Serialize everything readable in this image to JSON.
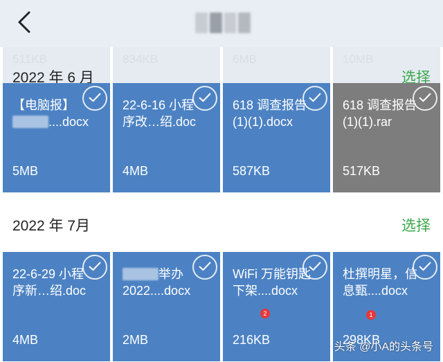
{
  "nav": {
    "back_icon": "chevron-left-icon"
  },
  "peek_row": {
    "sizes": [
      "511KB",
      "834KB",
      "6MB",
      "10MB"
    ]
  },
  "june": {
    "title": "2022 年 6 月",
    "select_label": "选择",
    "tiles": [
      {
        "name_line1": "【电脑报】",
        "name_line2": "....docx",
        "size": "5MB"
      },
      {
        "name_line1": "22-6-16 小程",
        "name_line2": "序改…绍.doc",
        "size": "4MB"
      },
      {
        "name_line1": "618 调查报告",
        "name_line2": "(1)(1).docx",
        "size": "587KB"
      },
      {
        "name_line1": "618 调查报告",
        "name_line2": "(1)(1).rar",
        "size": "517KB"
      }
    ]
  },
  "july": {
    "title": "2022 年 7月",
    "select_label": "选择",
    "tiles": [
      {
        "name_line1": "22-6-29 小程",
        "name_line2": "序新…绍.doc",
        "size": "4MB"
      },
      {
        "name_line1": "举办",
        "name_line2": "2022....docx",
        "size": "2MB"
      },
      {
        "name_line1": "WiFi 万能钥匙",
        "name_line2": "下架....docx",
        "size": "216KB",
        "badge": "2"
      },
      {
        "name_line1": "杜撰明星，信",
        "name_line2": "息甄....docx",
        "size": "298KB",
        "badge": "1"
      }
    ]
  },
  "watermark": "头条 @小A的头条号",
  "colors": {
    "tile_blue": "#4c82c3",
    "tile_gray": "#7d7d7d",
    "select_green": "#3aa84a",
    "badge_red": "#e5383b"
  }
}
